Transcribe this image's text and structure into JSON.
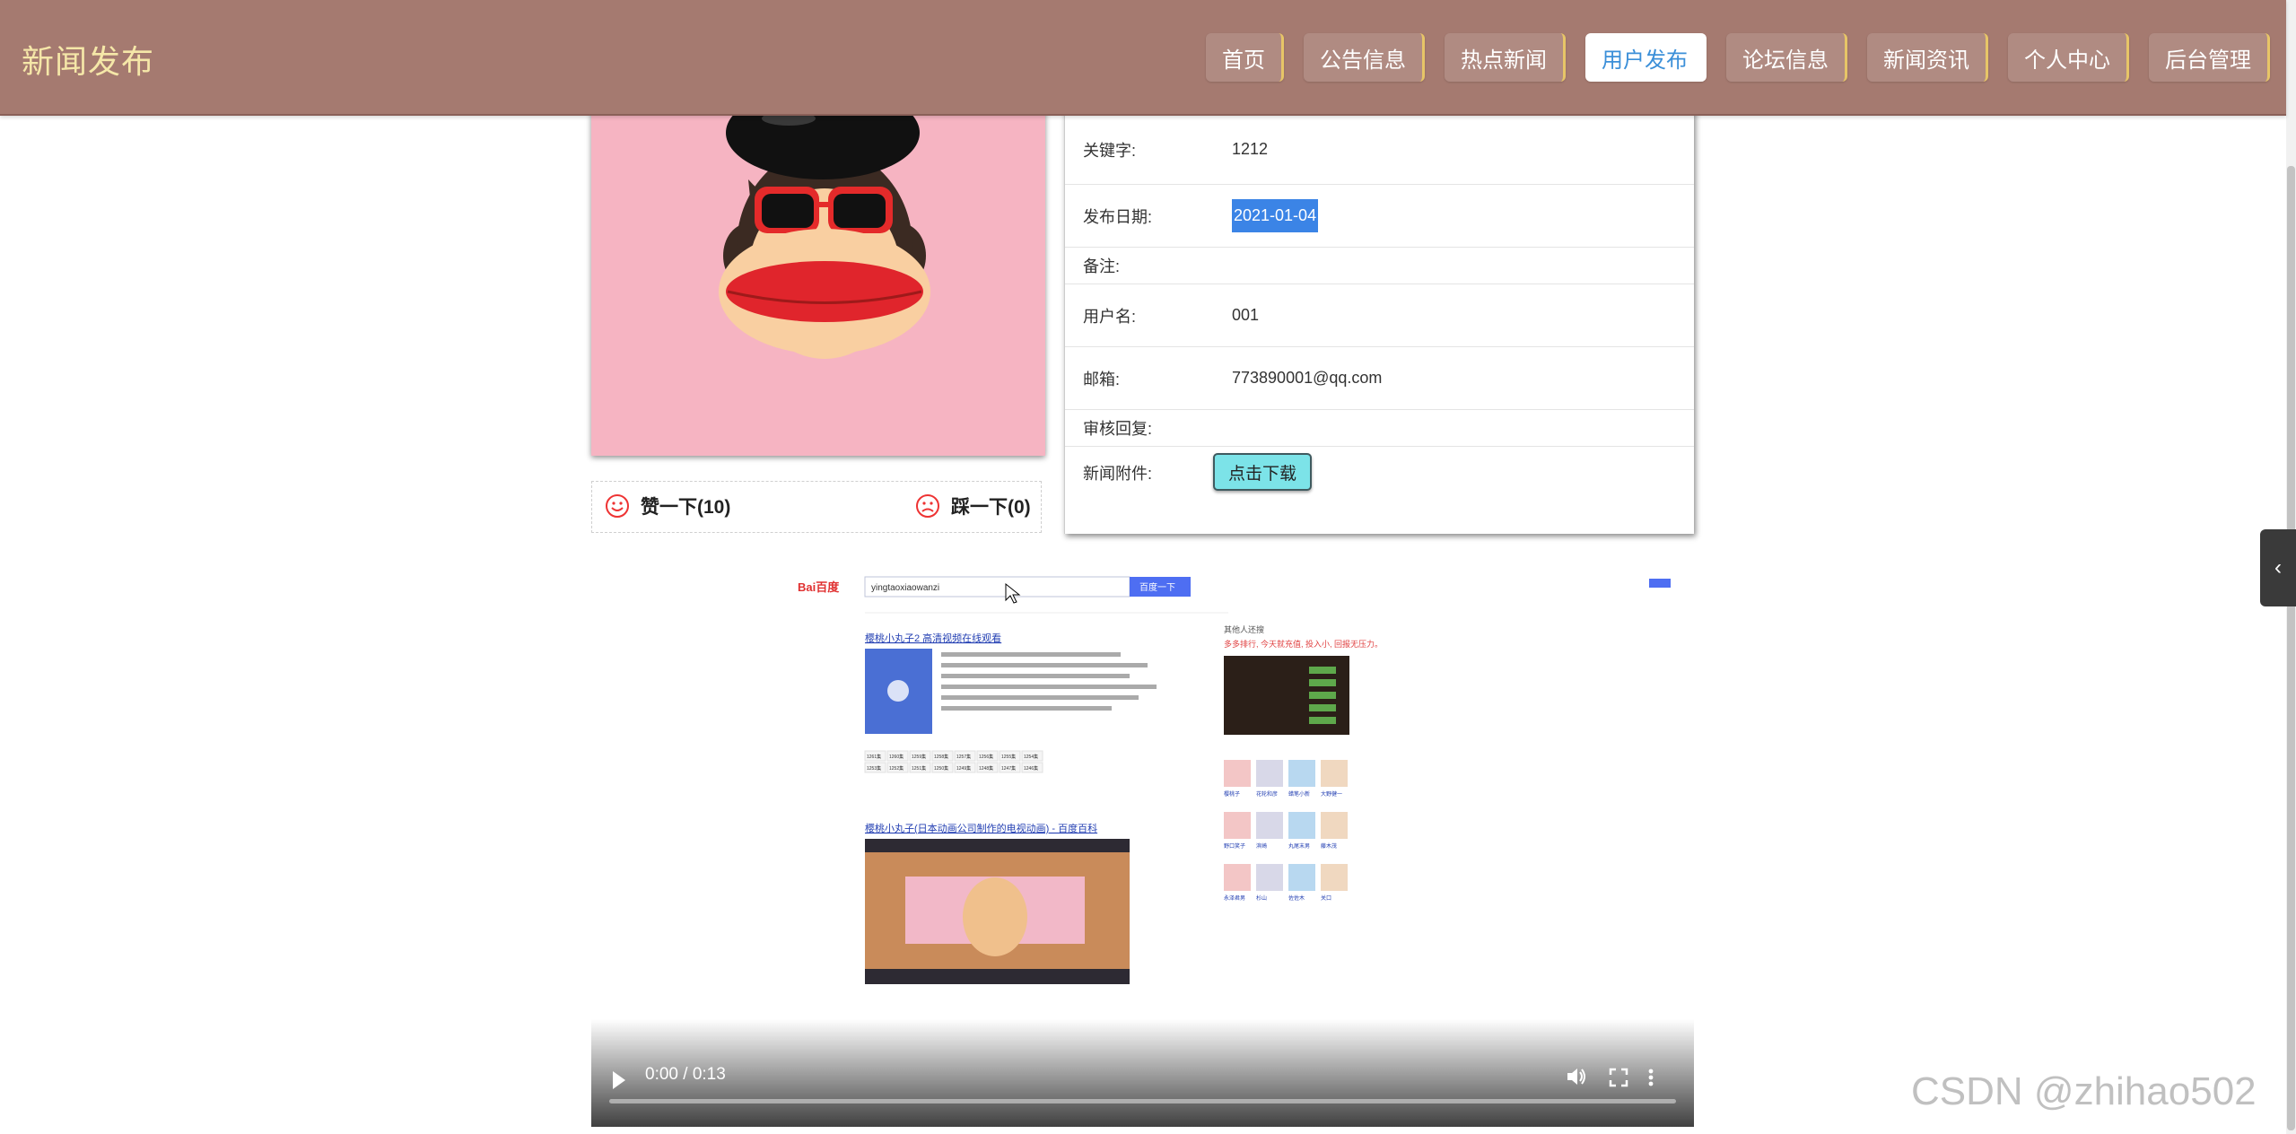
{
  "header": {
    "brand": "新闻发布",
    "nav": [
      "首页",
      "公告信息",
      "热点新闻",
      "用户发布",
      "论坛信息",
      "新闻资讯",
      "个人中心",
      "后台管理"
    ],
    "active_index": 3
  },
  "detail": {
    "keyword_label": "关键字:",
    "keyword_value": "1212",
    "date_label": "发布日期:",
    "date_value": "2021-01-04",
    "remark_label": "备注:",
    "remark_value": "",
    "username_label": "用户名:",
    "username_value": "001",
    "email_label": "邮箱:",
    "email_value": "773890001@qq.com",
    "review_label": "审核回复:",
    "review_value": "",
    "attachment_label": "新闻附件:",
    "download_label": "点击下载"
  },
  "votes": {
    "like_label": "赞一下(10)",
    "dislike_label": "踩一下(0)"
  },
  "video": {
    "time_display": "0:00 / 0:13",
    "progress": 0,
    "frame": {
      "logo": "Bai百度",
      "query": "yingtaoxiaowanzi",
      "search_button": "百度一下",
      "result_title_1": "樱桃小丸子2 高清视频在线观看",
      "result_title_2": "樱桃小丸子(日本动画公司制作的电视动画) - 百度百科",
      "episodes": [
        "1261集",
        "1260集",
        "1259集",
        "1258集",
        "1257集",
        "1256集",
        "1255集",
        "1254集",
        "1253集",
        "1252集",
        "1251集",
        "1250集",
        "1249集",
        "1248集",
        "1247集",
        "1246集"
      ],
      "ad_text": "多多排行, 今天就充值, 投入小, 回报无压力。",
      "related_header": "其他人还搜",
      "characters": [
        "樱桃子",
        "花轮和彦",
        "蜡笔小新",
        "大野健一",
        "野口笑子",
        "滨崎",
        "丸尾末男",
        "藤木茂",
        "永泽君男",
        "杉山",
        "佐佐木",
        "关口"
      ]
    }
  },
  "side_tab_icon": "chevron-left-icon",
  "watermark": "CSDN @zhihao502",
  "colors": {
    "nav_bg": "#a57a70",
    "brand": "#f5e7a8",
    "nav_underline": "#e7c567",
    "active_text": "#3b8fd8",
    "download_bg": "#7ce3e8",
    "date_highlight": "#3b84e6"
  }
}
